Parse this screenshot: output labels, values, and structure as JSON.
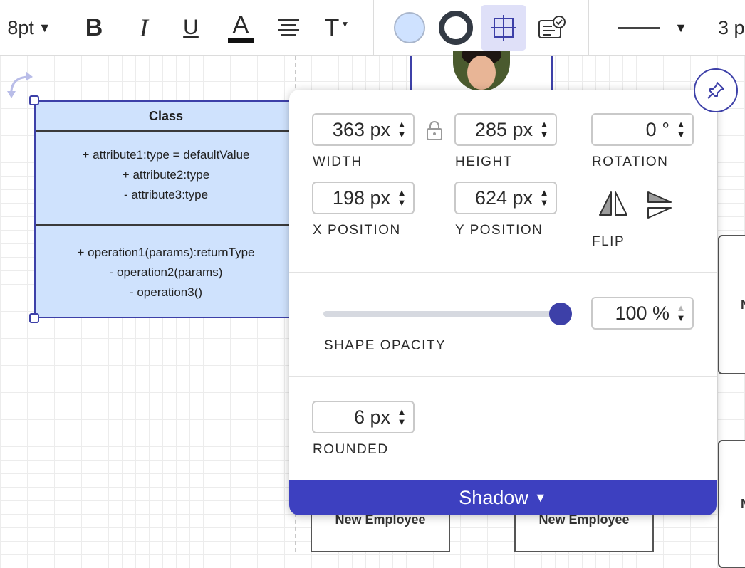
{
  "toolbar": {
    "font_size": "8pt",
    "bold": "B",
    "italic": "I",
    "underline": "U",
    "text_color": "A",
    "text_style": "T",
    "stroke_width": "3 p",
    "fill_color": "#cfe2ff",
    "stroke_color": "#333a44",
    "active_color": "#dfe0f8"
  },
  "uml": {
    "title": "Class",
    "attributes": [
      "+ attribute1:type = defaultValue",
      "+ attribute2:type",
      "- attribute3:type"
    ],
    "operations": [
      "+ operation1(params):returnType",
      "- operation2(params)",
      "- operation3()"
    ]
  },
  "cards": {
    "employee_1": "New Employee",
    "employee_2": "New Employee",
    "right_1": "N",
    "right_2": "N"
  },
  "panel": {
    "width_value": "363 px",
    "width_label": "WIDTH",
    "height_value": "285 px",
    "height_label": "HEIGHT",
    "rotation_value": "0 °",
    "rotation_label": "ROTATION",
    "x_value": "198 px",
    "x_label": "X POSITION",
    "y_value": "624 px",
    "y_label": "Y POSITION",
    "flip_label": "FLIP",
    "opacity_value": "100 %",
    "opacity_label": "SHAPE OPACITY",
    "opacity_fraction": 1.0,
    "rounded_value": "6 px",
    "rounded_label": "ROUNDED",
    "shadow_label": "Shadow"
  },
  "colors": {
    "accent": "#3d40a8",
    "shadow_bar": "#3d40c0",
    "shape_fill": "#cfe2fd"
  },
  "icons": [
    "chevron-down-icon",
    "text-align-icon",
    "select-icon",
    "checklist-icon",
    "lock-icon",
    "flip-horizontal-icon",
    "flip-vertical-icon",
    "pin-icon",
    "rotate-icon",
    "stepper-icon"
  ]
}
